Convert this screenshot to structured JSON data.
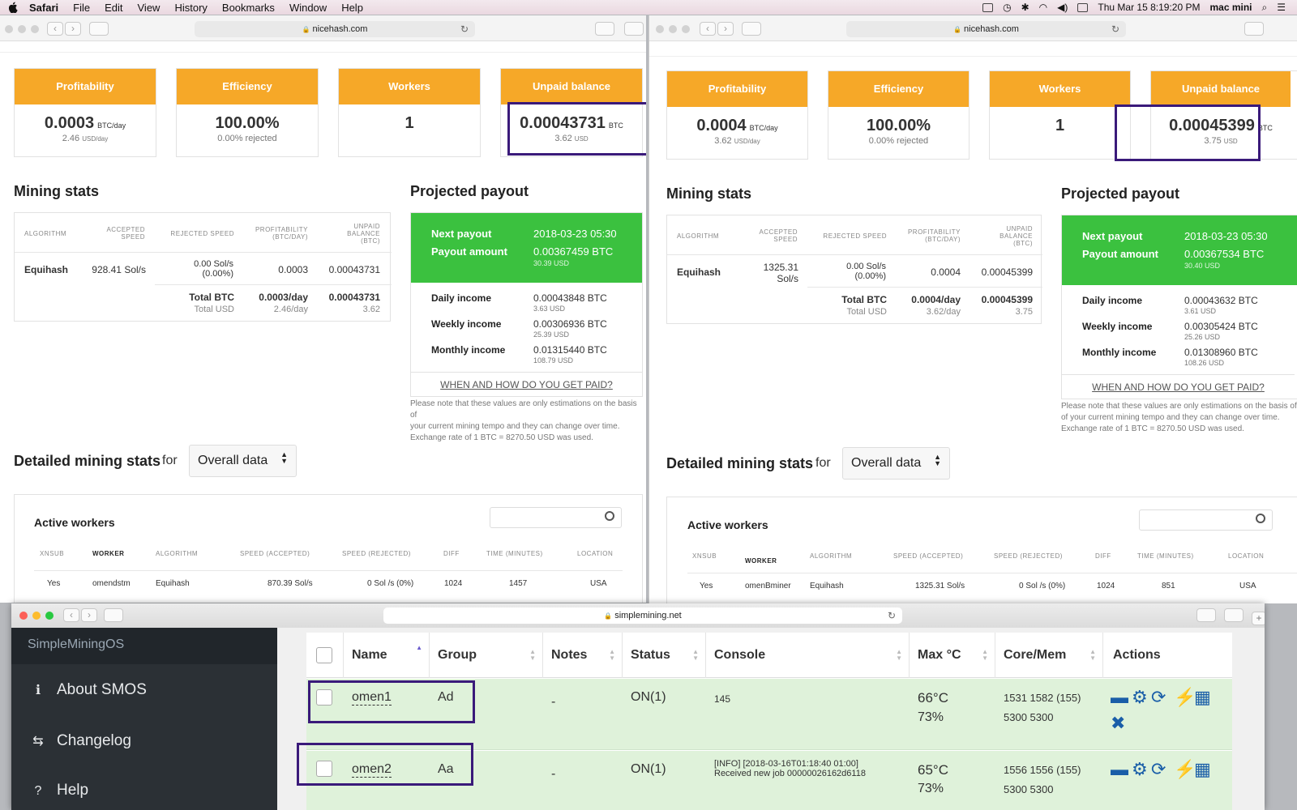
{
  "menubar": {
    "app": "Safari",
    "items": [
      "File",
      "Edit",
      "View",
      "History",
      "Bookmarks",
      "Window",
      "Help"
    ],
    "clock": "Thu Mar 15  8:19:20 PM",
    "user": "mac mini"
  },
  "left": {
    "url": "nicehash.com",
    "cards": [
      {
        "title": "Profitability",
        "value": "0.0003",
        "unit": "BTC/day",
        "sub": "2.46",
        "subunit": "USD/day"
      },
      {
        "title": "Efficiency",
        "value": "100.00%",
        "unit": "",
        "sub": "0.00% rejected",
        "subunit": ""
      },
      {
        "title": "Workers",
        "value": "1",
        "unit": "",
        "sub": "",
        "subunit": ""
      },
      {
        "title": "Unpaid balance",
        "value": "0.00043731",
        "unit": "BTC",
        "sub": "3.62",
        "subunit": "USD"
      }
    ],
    "mining": {
      "title": "Mining stats",
      "headers": [
        "ALGORITHM",
        "ACCEPTED SPEED",
        "REJECTED SPEED",
        "PROFITABILITY (BTC/DAY)",
        "UNPAID BALANCE (BTC)"
      ],
      "algo": "Equihash",
      "accepted": "928.41 Sol/s",
      "rejected": "0.00 Sol/s (0.00%)",
      "profit": "0.0003",
      "unpaid": "0.00043731",
      "total_btc": "Total BTC",
      "total_usd": "Total USD",
      "total_profit": "0.0003/day",
      "total_profit_usd": "2.46/day",
      "total_unpaid": "0.00043731",
      "total_unpaid_usd": "3.62"
    },
    "payout": {
      "title": "Projected payout",
      "next_label": "Next payout",
      "next": "2018-03-23 05:30",
      "amount_label": "Payout amount",
      "amount": "0.00367459 BTC",
      "amount_usd": "30.39 USD",
      "daily_label": "Daily income",
      "daily": "0.00043848 BTC",
      "daily_usd": "3.63 USD",
      "weekly_label": "Weekly income",
      "weekly": "0.00306936 BTC",
      "weekly_usd": "25.39 USD",
      "monthly_label": "Monthly income",
      "monthly": "0.01315440 BTC",
      "monthly_usd": "108.79 USD",
      "link": "WHEN AND HOW DO YOU GET PAID?",
      "note1": "Please note that these values are only estimations on the basis of",
      "note2": "your current mining tempo and they can change over time.",
      "note3": "Exchange rate of 1 BTC = 8270.50 USD was used."
    },
    "detailed": {
      "title": "Detailed mining stats",
      "for": "for",
      "select": "Overall data"
    },
    "workers": {
      "title": "Active workers",
      "headers": [
        "XNSUB",
        "WORKER",
        "ALGORITHM",
        "SPEED (ACCEPTED)",
        "SPEED (REJECTED)",
        "DIFF",
        "TIME (MINUTES)",
        "LOCATION"
      ],
      "row": [
        "Yes",
        "omendstm",
        "Equihash",
        "870.39 Sol/s",
        "0 Sol /s (0%)",
        "1024",
        "1457",
        "USA"
      ]
    }
  },
  "right": {
    "url": "nicehash.com",
    "cards": [
      {
        "title": "Profitability",
        "value": "0.0004",
        "unit": "BTC/day",
        "sub": "3.62",
        "subunit": "USD/day"
      },
      {
        "title": "Efficiency",
        "value": "100.00%",
        "unit": "",
        "sub": "0.00% rejected",
        "subunit": ""
      },
      {
        "title": "Workers",
        "value": "1",
        "unit": "",
        "sub": "",
        "subunit": ""
      },
      {
        "title": "Unpaid balance",
        "value": "0.00045399",
        "unit": "BTC",
        "sub": "3.75",
        "subunit": "USD"
      }
    ],
    "mining": {
      "title": "Mining stats",
      "headers": [
        "ALGORITHM",
        "ACCEPTED SPEED",
        "REJECTED SPEED",
        "PROFITABILITY (BTC/DAY)",
        "UNPAID BALANCE (BTC)"
      ],
      "algo": "Equihash",
      "accepted": "1325.31 Sol/s",
      "rejected": "0.00 Sol/s (0.00%)",
      "profit": "0.0004",
      "unpaid": "0.00045399",
      "total_btc": "Total BTC",
      "total_usd": "Total USD",
      "total_profit": "0.0004/day",
      "total_profit_usd": "3.62/day",
      "total_unpaid": "0.00045399",
      "total_unpaid_usd": "3.75"
    },
    "payout": {
      "title": "Projected payout",
      "next_label": "Next payout",
      "next": "2018-03-23 05:30",
      "amount_label": "Payout amount",
      "amount": "0.00367534 BTC",
      "amount_usd": "30.40 USD",
      "daily_label": "Daily income",
      "daily": "0.00043632 BTC",
      "daily_usd": "3.61 USD",
      "weekly_label": "Weekly income",
      "weekly": "0.00305424 BTC",
      "weekly_usd": "25.26 USD",
      "monthly_label": "Monthly income",
      "monthly": "0.01308960 BTC",
      "monthly_usd": "108.26 USD",
      "link": "WHEN AND HOW DO YOU GET PAID?",
      "note1": "Please note that these values are only estimations on the basis of",
      "note2": "of your current mining tempo and they can change over time.",
      "note3": "Exchange rate of 1 BTC = 8270.50 USD was used."
    },
    "detailed": {
      "title": "Detailed mining stats",
      "for": "for",
      "select": "Overall data"
    },
    "workers": {
      "title": "Active workers",
      "headers": [
        "XNSUB",
        "WORKER",
        "ALGORITHM",
        "SPEED (ACCEPTED)",
        "SPEED (REJECTED)",
        "DIFF",
        "TIME (MINUTES)",
        "LOCATION"
      ],
      "row": [
        "Yes",
        "omenBminer",
        "Equihash",
        "1325.31 Sol/s",
        "0 Sol /s (0%)",
        "1024",
        "851",
        "USA"
      ]
    }
  },
  "smos": {
    "url": "simplemining.net",
    "brand": "SimpleMiningOS",
    "nav": [
      "About SMOS",
      "Changelog",
      "Help"
    ],
    "headers": [
      "Name",
      "Group",
      "Notes",
      "Status",
      "Console",
      "Max °C",
      "Core/Mem",
      "Actions"
    ],
    "rows": [
      {
        "name": "omen1",
        "group": "Ad",
        "notes": "-",
        "status": "ON(1)",
        "console1": "145",
        "console2": "",
        "temp": "66°C",
        "fan": "73%",
        "core1": "1531 1582 (155)",
        "core2": "5300 5300"
      },
      {
        "name": "omen2",
        "group": "Aa",
        "notes": "-",
        "status": "ON(1)",
        "console1": "[INFO] [2018-03-16T01:18:40 01:00]",
        "console2": "Received new job 00000026162d6118",
        "temp": "65°C",
        "fan": "73%",
        "core1": "1556 1556 (155)",
        "core2": "5300 5300"
      }
    ]
  }
}
